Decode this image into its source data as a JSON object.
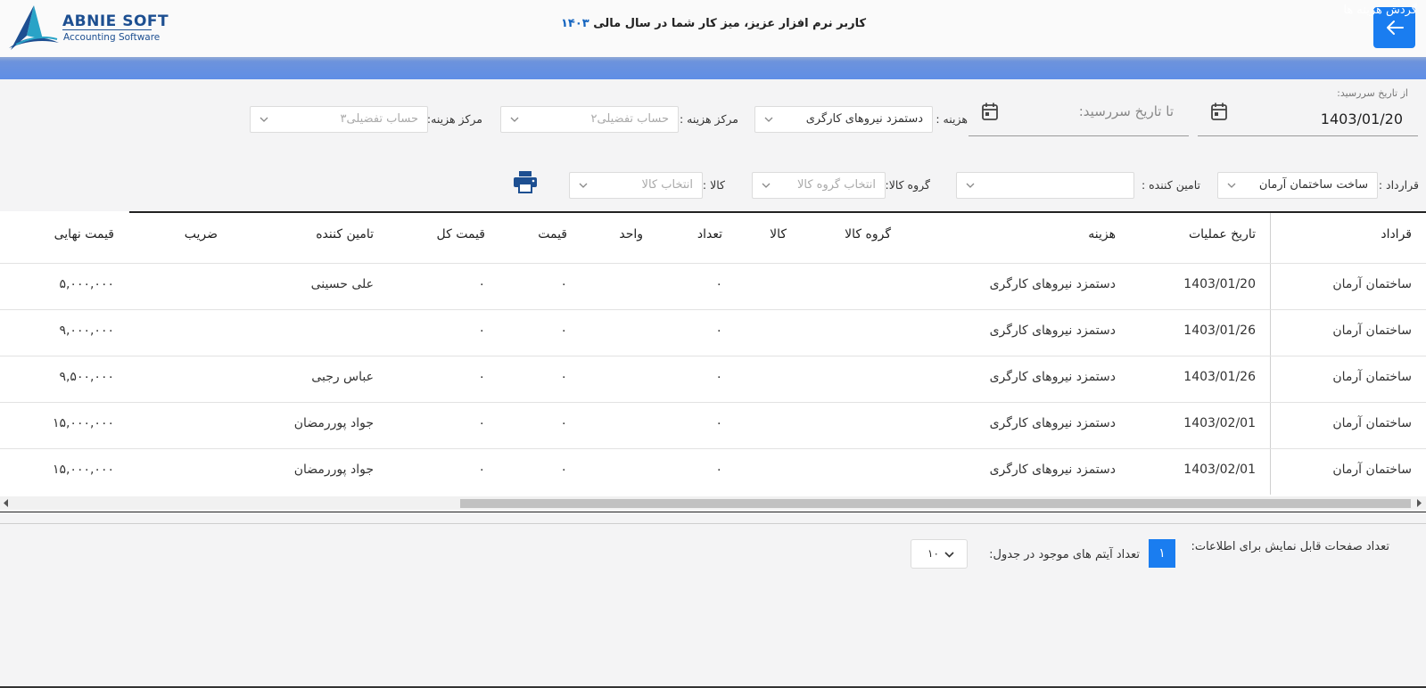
{
  "header": {
    "logo_title": "ABNIE SOFT",
    "logo_subtitle": "Accounting Software",
    "welcome_text": "کاربر نرم افزار عزیز، میز کار شما در سال مالی",
    "fiscal_year": "۱۴۰۳",
    "back_icon": "arrow-left-icon"
  },
  "section": {
    "title": "گردش هزینه ها"
  },
  "filters": {
    "from_date_label": "از تاریخ سررسید:",
    "from_date_value": "1403/01/20",
    "to_date_placeholder": "تا تاریخ سررسید:",
    "calendar_icon": "calendar-icon",
    "cost_label": "هزینه :",
    "cost_value": "دستمزد نیروهای کارگری",
    "cost_center_label": "مرکز هزینه :",
    "cost_center_placeholder": "حساب تفضیلی۲",
    "cost_center2_label": "مرکز هزینه:",
    "cost_center2_placeholder": "حساب تفضیلی۳",
    "contract_label": "قرارداد :",
    "contract_value": "ساخت ساختمان آرمان",
    "supplier_label": "تامین کننده :",
    "supplier_value": "",
    "goods_group_label": "گروه کالا:",
    "goods_group_placeholder": "انتخاب گروه کالا",
    "goods_label": "کالا :",
    "goods_placeholder": "انتخاب کالا",
    "print_icon": "printer-icon"
  },
  "table": {
    "headers": {
      "contract": "قراداد",
      "op_date": "تاریخ عملیات",
      "cost": "هزینه",
      "goods_group": "گروه کالا",
      "goods": "کالا",
      "qty": "تعداد",
      "unit": "واحد",
      "price": "قیمت",
      "total": "قیمت کل",
      "supplier": "تامین کننده",
      "factor": "ضریب",
      "final_price": "قیمت نهایی"
    },
    "rows": [
      {
        "contract": "ساختمان آرمان",
        "op_date": "1403/01/20",
        "cost": "دستمزد نیروهای کارگری",
        "qty": "۰",
        "price": "۰",
        "total": "۰",
        "supplier": "علی حسینی",
        "final_price": "۵,۰۰۰,۰۰۰"
      },
      {
        "contract": "ساختمان آرمان",
        "op_date": "1403/01/26",
        "cost": "دستمزد نیروهای کارگری",
        "qty": "۰",
        "price": "۰",
        "total": "۰",
        "supplier": "",
        "final_price": "۹,۰۰۰,۰۰۰"
      },
      {
        "contract": "ساختمان آرمان",
        "op_date": "1403/01/26",
        "cost": "دستمزد نیروهای کارگری",
        "qty": "۰",
        "price": "۰",
        "total": "۰",
        "supplier": "عباس رجبی",
        "final_price": "۹,۵۰۰,۰۰۰"
      },
      {
        "contract": "ساختمان آرمان",
        "op_date": "1403/02/01",
        "cost": "دستمزد نیروهای کارگری",
        "qty": "۰",
        "price": "۰",
        "total": "۰",
        "supplier": "جواد پوررمضان",
        "final_price": "۱۵,۰۰۰,۰۰۰"
      },
      {
        "contract": "ساختمان آرمان",
        "op_date": "1403/02/01",
        "cost": "دستمزد نیروهای کارگری",
        "qty": "۰",
        "price": "۰",
        "total": "۰",
        "supplier": "جواد پوررمضان",
        "final_price": "۱۵,۰۰۰,۰۰۰"
      }
    ]
  },
  "footer": {
    "pages_label": "تعداد صفحات قابل نمایش برای اطلاعات:",
    "current_page": "۱",
    "items_label": "تعداد آیتم های موجود در جدول:",
    "per_page_value": "۱۰"
  },
  "colors": {
    "accent": "#1a7df0",
    "section_bar": "#5f8ee6",
    "brand": "#1d4f91"
  }
}
